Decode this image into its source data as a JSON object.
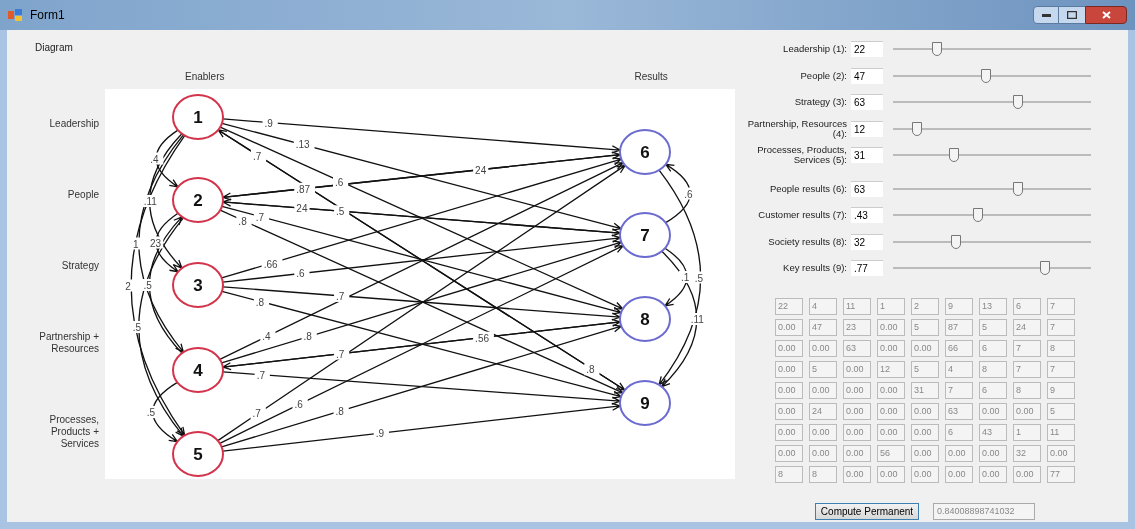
{
  "window": {
    "title": "Form1"
  },
  "menu": [
    "Diagram"
  ],
  "diagram": {
    "enablers_heading": "Enablers",
    "results_heading": "Results",
    "row_labels": [
      "Leadership",
      "People",
      "Strategy",
      "Partnership + Resources",
      "Processes, Products + Services"
    ],
    "nodes": [
      {
        "label": "1",
        "kind": "enabler"
      },
      {
        "label": "2",
        "kind": "enabler"
      },
      {
        "label": "3",
        "kind": "enabler"
      },
      {
        "label": "4",
        "kind": "enabler"
      },
      {
        "label": "5",
        "kind": "enabler"
      },
      {
        "label": "6",
        "kind": "result"
      },
      {
        "label": "7",
        "kind": "result"
      },
      {
        "label": "8",
        "kind": "result"
      },
      {
        "label": "9",
        "kind": "result"
      }
    ],
    "edge_labels": [
      ".9",
      ".13",
      ".6",
      ".7",
      ".4",
      "2",
      ".11",
      "1",
      ".87",
      ".5",
      ".7",
      ".8",
      "23",
      ".5",
      ".66",
      ".6",
      ".7",
      ".8",
      ".5",
      ".4",
      ".8",
      ".7",
      ".7",
      ".5",
      ".7",
      ".6",
      ".8",
      ".9",
      "24",
      ".56",
      ".8",
      "24",
      ".5",
      ".6",
      ".1",
      ".11"
    ]
  },
  "sliders": [
    {
      "label": "Leadership (1):",
      "value": "22",
      "level": 0.22
    },
    {
      "label": "People (2):",
      "value": "47",
      "level": 0.47
    },
    {
      "label": "Strategy (3):",
      "value": "63",
      "level": 0.63
    },
    {
      "label": "Partnership, Resources (4):",
      "value": "12",
      "level": 0.12
    },
    {
      "label": "Processes, Products, Services (5):",
      "value": "31",
      "level": 0.31
    },
    {
      "label": "People results (6):",
      "value": "63",
      "level": 0.63
    },
    {
      "label": "Customer results (7):",
      "value": ".43",
      "level": 0.43
    },
    {
      "label": "Society results (8):",
      "value": "32",
      "level": 0.32
    },
    {
      "label": "Key results (9):",
      "value": ".77",
      "level": 0.77
    }
  ],
  "matrix": [
    [
      "22",
      "4",
      "11",
      "1",
      "2",
      "9",
      "13",
      "6",
      "7"
    ],
    [
      "0.00",
      "47",
      "23",
      "0.00",
      "5",
      "87",
      "5",
      "24",
      "7"
    ],
    [
      "0.00",
      "0.00",
      "63",
      "0.00",
      "0.00",
      "66",
      "6",
      "7",
      "8"
    ],
    [
      "0.00",
      "5",
      "0.00",
      "12",
      "5",
      "4",
      "8",
      "7",
      "7"
    ],
    [
      "0.00",
      "0.00",
      "0.00",
      "0.00",
      "31",
      "7",
      "6",
      "8",
      "9"
    ],
    [
      "0.00",
      "24",
      "0.00",
      "0.00",
      "0.00",
      "63",
      "0.00",
      "0.00",
      "5"
    ],
    [
      "0.00",
      "0.00",
      "0.00",
      "0.00",
      "0.00",
      "6",
      "43",
      "1",
      "11"
    ],
    [
      "0.00",
      "0.00",
      "0.00",
      "56",
      "0.00",
      "0.00",
      "0.00",
      "32",
      "0.00"
    ],
    [
      "8",
      "8",
      "0.00",
      "0.00",
      "0.00",
      "0.00",
      "0.00",
      "0.00",
      "77"
    ]
  ],
  "compute_button": "Compute Permanent",
  "result": "0.84008898741032"
}
